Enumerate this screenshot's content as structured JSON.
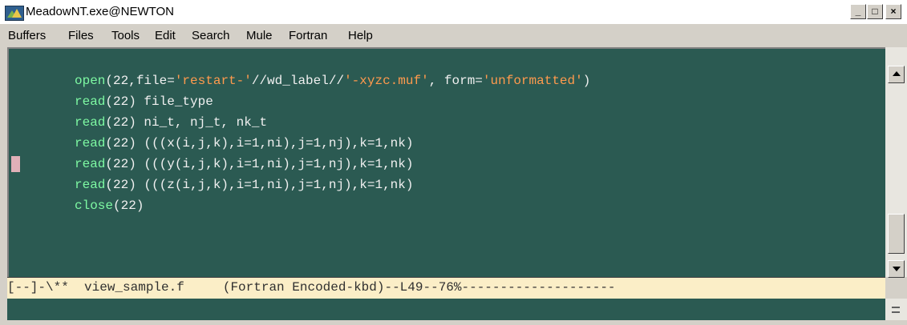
{
  "window": {
    "title": "MeadowNT.exe@NEWTON",
    "buttons": {
      "minimize": "_",
      "maximize": "□",
      "close": "×"
    }
  },
  "menubar": {
    "items": [
      "Buffers",
      "Files",
      "Tools",
      "Edit",
      "Search",
      "Mule",
      "Fortran",
      "Help"
    ]
  },
  "editor": {
    "colors": {
      "background": "#2b5a52",
      "keyword": "#7ef9a3",
      "string": "#ff9a4d",
      "text": "#f0f0f0"
    },
    "lines": [
      {
        "kw": "open",
        "rest1": "(22,file=",
        "str1": "'restart-'",
        "rest2": "//wd_label//",
        "str2": "'-xyzc.muf'",
        "rest3": ", form=",
        "str3": "'unformatted'",
        "rest4": ")"
      },
      {
        "kw": "read",
        "rest": "(22) file_type"
      },
      {
        "kw": "read",
        "rest": "(22) ni_t, nj_t, nk_t"
      },
      {
        "kw": "read",
        "rest": "(22) (((x(i,j,k),i=1,ni),j=1,nj),k=1,nk)"
      },
      {
        "kw": "read",
        "rest": "(22) (((y(i,j,k),i=1,ni),j=1,nj),k=1,nk)"
      },
      {
        "kw": "read",
        "rest": "(22) (((z(i,j,k),i=1,ni),j=1,nj),k=1,nk)"
      },
      {
        "kw": "close",
        "rest": "(22)"
      }
    ]
  },
  "modeline": {
    "text": "[--]-\\**  view_sample.f     (Fortran Encoded-kbd)--L49--76%--------------------"
  }
}
